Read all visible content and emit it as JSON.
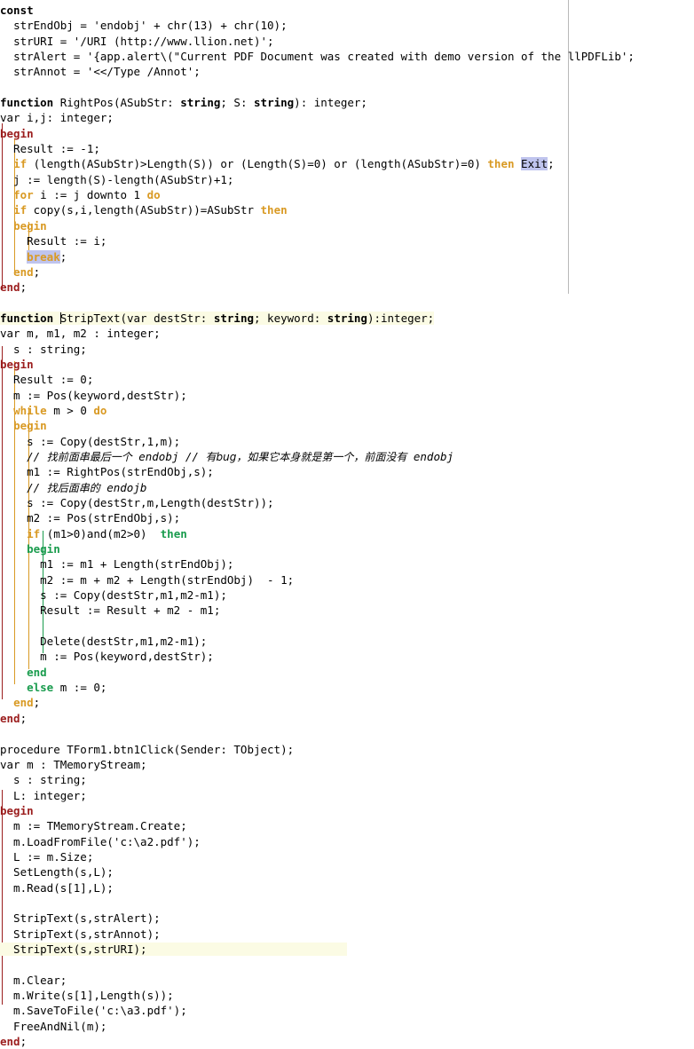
{
  "editor": {
    "name": "delphi-code-editor",
    "language": "Object Pascal / Delphi",
    "colors": {
      "background": "#ffffff",
      "text": "#000000",
      "keyword_red": "#9b1d1d",
      "keyword_orange": "#d99a24",
      "keyword_green": "#1a9c4e",
      "selection": "#bfc4ee",
      "current_line": "#fbfbe4",
      "margin_line": "#b9b9b9"
    },
    "margin_ruler_column": 80
  },
  "code": {
    "line_001": "const",
    "line_002_indent": "  ",
    "line_002": "strEndObj = 'endobj' + chr(13) + chr(10);",
    "line_003": "strURI = '/URI (http://www.llion.net)';",
    "line_004": "strAlert = '{app.alert\\(\"Current PDF Document was created with demo version of the llPDFLib';",
    "line_005": "strAnnot = '<</Type /Annot';",
    "line_006": "",
    "line_007_a": "function",
    "line_007_b": " RightPos(ASubStr: ",
    "line_007_c": "string",
    "line_007_d": "; S: ",
    "line_007_e": "string",
    "line_007_f": "): integer;",
    "line_008": "var i,j: integer;",
    "line_009": "begin",
    "line_010": "  Result := -1;",
    "line_011_if": "if",
    "line_011_cond": " (length(ASubStr)>Length(S)) or (Length(S)=0) or (length(ASubStr)=0) ",
    "line_011_then": "then",
    "line_011_exit": "Exit",
    "line_011_semi": ";",
    "line_012": "  j := length(S)-length(ASubStr)+1;",
    "line_013_for": "for",
    "line_013_mid": " i := j downto 1 ",
    "line_013_do": "do",
    "line_014_if": "if",
    "line_014_mid": " copy(s,i,length(ASubStr))=ASubStr ",
    "line_014_then": "then",
    "line_015": "begin",
    "line_016": "    Result := i;",
    "line_017_break": "break",
    "line_017_semi": ";",
    "line_018": "end",
    "line_018_semi": ";",
    "line_019": "end",
    "line_019_semi": ";",
    "line_020": "",
    "line_021_a": "function",
    "line_021_b": "StripText(var destStr: ",
    "line_021_c": "string",
    "line_021_d": "; keyword: ",
    "line_021_e": "string",
    "line_021_f": "):integer;",
    "line_022": "var m, m1, m2 : integer;",
    "line_023": "  s : string;",
    "line_024": "begin",
    "line_025": "  Result := 0;",
    "line_026": "  m := Pos(keyword,destStr);",
    "line_027_while": "while",
    "line_027_mid": " m > 0 ",
    "line_027_do": "do",
    "line_028": "begin",
    "line_029": "    s := Copy(destStr,1,m);",
    "line_030_slashes": "// ",
    "line_030_cn1": "找前面串最后一个",
    "line_030_mid": " endobj // ",
    "line_030_cn2": "有bug，如果它本身就是第一个，前面没有",
    "line_030_end": " endobj",
    "line_031": "    m1 := RightPos(strEndObj,s);",
    "line_032_slashes": "// ",
    "line_032_cn": "找后面串的",
    "line_032_end": " endojb",
    "line_033": "    s := Copy(destStr,m,Length(destStr));",
    "line_034": "    m2 := Pos(strEndObj,s);",
    "line_035_if": "if",
    "line_035_mid": " (m1>0)and(m2>0)  ",
    "line_035_then": "then",
    "line_036": "begin",
    "line_037": "      m1 := m1 + Length(strEndObj);",
    "line_038": "      m2 := m + m2 + Length(strEndObj)  - 1;",
    "line_039": "      s := Copy(destStr,m1,m2-m1);",
    "line_040": "      Result := Result + m2 - m1;",
    "line_041": "",
    "line_042": "      Delete(destStr,m1,m2-m1);",
    "line_043": "      m := Pos(keyword,destStr);",
    "line_044": "end",
    "line_045_else": "else",
    "line_045_mid": " m := 0;",
    "line_046": "end",
    "line_046_semi": ";",
    "line_047": "end",
    "line_047_semi": ";",
    "line_048": "",
    "line_049": "procedure TForm1.btn1Click(Sender: TObject);",
    "line_050": "var m : TMemoryStream;",
    "line_051": "  s : string;",
    "line_052": "  L: integer;",
    "line_053": "begin",
    "line_054": "  m := TMemoryStream.Create;",
    "line_055": "  m.LoadFromFile('c:\\a2.pdf');",
    "line_056": "  L := m.Size;",
    "line_057": "  SetLength(s,L);",
    "line_058": "  m.Read(s[1],L);",
    "line_059": "",
    "line_060": "  StripText(s,strAlert);",
    "line_061": "  StripText(s,strAnnot);",
    "line_062": "  StripText(s,strURI);",
    "line_063": "",
    "line_064": "  m.Clear;",
    "line_065": "  m.Write(s[1],Length(s));",
    "line_066": "  m.SaveToFile('c:\\a3.pdf');",
    "line_067": "  FreeAndNil(m);",
    "line_068": "end",
    "line_068_semi": ";"
  }
}
